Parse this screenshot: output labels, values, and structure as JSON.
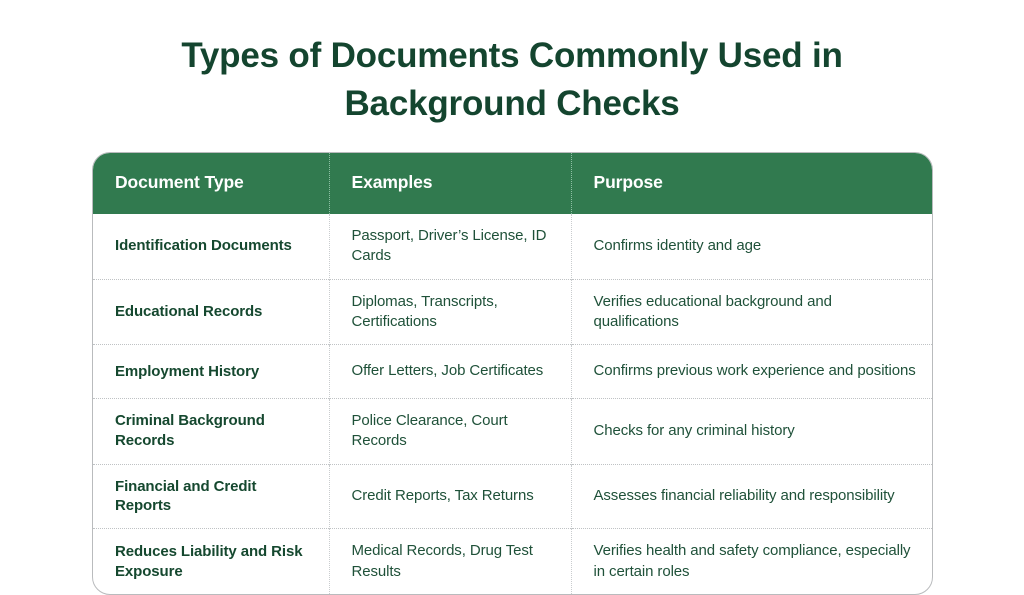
{
  "page": {
    "background_color": "#ffffff",
    "title": "Types of Documents Commonly Used in Background Checks",
    "title_color": "#14452f"
  },
  "table": {
    "header_background": "#317a4f",
    "header_text_color": "#ffffff",
    "body_text_color": "#1f5139",
    "type_text_color": "#15482f",
    "columns": [
      {
        "key": "document_type",
        "label": "Document Type"
      },
      {
        "key": "examples",
        "label": "Examples"
      },
      {
        "key": "purpose",
        "label": "Purpose"
      }
    ],
    "rows": [
      {
        "document_type": "Identification Documents",
        "examples": "Passport, Driver’s License, ID Cards",
        "purpose": "Confirms identity and age"
      },
      {
        "document_type": "Educational Records",
        "examples": "Diplomas, Transcripts, Certifications",
        "purpose": "Verifies educational background and qualifications"
      },
      {
        "document_type": "Employment History",
        "examples": "Offer Letters, Job Certificates",
        "purpose": "Confirms previous work experience and positions"
      },
      {
        "document_type": "Criminal Background Records",
        "examples": "Police Clearance, Court Records",
        "purpose": "Checks for any criminal history"
      },
      {
        "document_type": "Financial and Credit Reports",
        "examples": "Credit Reports, Tax Returns",
        "purpose": "Assesses financial reliability and responsibility"
      },
      {
        "document_type": "Reduces Liability and Risk Exposure",
        "examples": "Medical Records, Drug Test Results",
        "purpose": "Verifies health and safety compliance, especially in certain roles"
      }
    ]
  }
}
